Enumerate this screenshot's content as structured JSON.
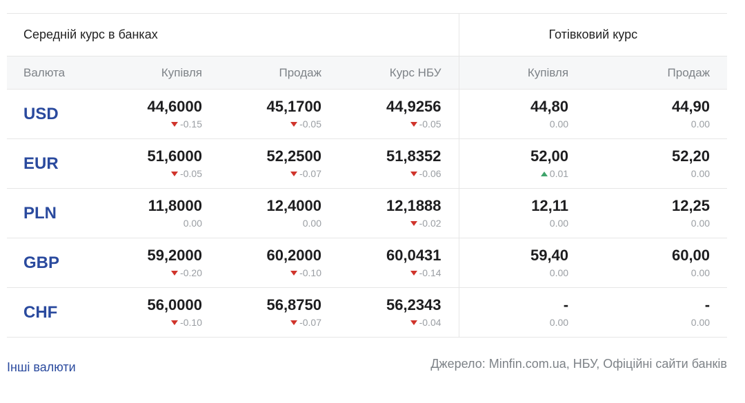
{
  "table": {
    "group_banks": "Середній курс в банках",
    "group_cash": "Готівковий курс",
    "headers": [
      "Валюта",
      "Купівля",
      "Продаж",
      "Курс НБУ",
      "Купівля",
      "Продаж"
    ],
    "rows": [
      {
        "code": "USD",
        "cells": [
          {
            "value": "44,6000",
            "change": "-0.15",
            "trend": "down"
          },
          {
            "value": "45,1700",
            "change": "-0.05",
            "trend": "down"
          },
          {
            "value": "44,9256",
            "change": "-0.05",
            "trend": "down"
          },
          {
            "value": "44,80",
            "change": "0.00",
            "trend": "none"
          },
          {
            "value": "44,90",
            "change": "0.00",
            "trend": "none"
          }
        ]
      },
      {
        "code": "EUR",
        "cells": [
          {
            "value": "51,6000",
            "change": "-0.05",
            "trend": "down"
          },
          {
            "value": "52,2500",
            "change": "-0.07",
            "trend": "down"
          },
          {
            "value": "51,8352",
            "change": "-0.06",
            "trend": "down"
          },
          {
            "value": "52,00",
            "change": "0.01",
            "trend": "up"
          },
          {
            "value": "52,20",
            "change": "0.00",
            "trend": "none"
          }
        ]
      },
      {
        "code": "PLN",
        "cells": [
          {
            "value": "11,8000",
            "change": "0.00",
            "trend": "none"
          },
          {
            "value": "12,4000",
            "change": "0.00",
            "trend": "none"
          },
          {
            "value": "12,1888",
            "change": "-0.02",
            "trend": "down"
          },
          {
            "value": "12,11",
            "change": "0.00",
            "trend": "none"
          },
          {
            "value": "12,25",
            "change": "0.00",
            "trend": "none"
          }
        ]
      },
      {
        "code": "GBP",
        "cells": [
          {
            "value": "59,2000",
            "change": "-0.20",
            "trend": "down"
          },
          {
            "value": "60,2000",
            "change": "-0.10",
            "trend": "down"
          },
          {
            "value": "60,0431",
            "change": "-0.14",
            "trend": "down"
          },
          {
            "value": "59,40",
            "change": "0.00",
            "trend": "none"
          },
          {
            "value": "60,00",
            "change": "0.00",
            "trend": "none"
          }
        ]
      },
      {
        "code": "CHF",
        "cells": [
          {
            "value": "56,0000",
            "change": "-0.10",
            "trend": "down"
          },
          {
            "value": "56,8750",
            "change": "-0.07",
            "trend": "down"
          },
          {
            "value": "56,2343",
            "change": "-0.04",
            "trend": "down"
          },
          {
            "value": "-",
            "change": "0.00",
            "trend": "none"
          },
          {
            "value": "-",
            "change": "0.00",
            "trend": "none"
          }
        ]
      }
    ]
  },
  "footer": {
    "other_link": "Інші валюти",
    "source": "Джерело: Minfin.com.ua, НБУ, Офіційні сайти банків"
  },
  "colors": {
    "currency_code": "#2a4a9e",
    "trend_down": "#d0342c",
    "trend_up": "#3ea36a",
    "header_bg": "#f6f7f8",
    "muted_text": "#7d8287"
  },
  "icons": {
    "trend_down": "triangle-down-icon",
    "trend_up": "triangle-up-icon"
  }
}
